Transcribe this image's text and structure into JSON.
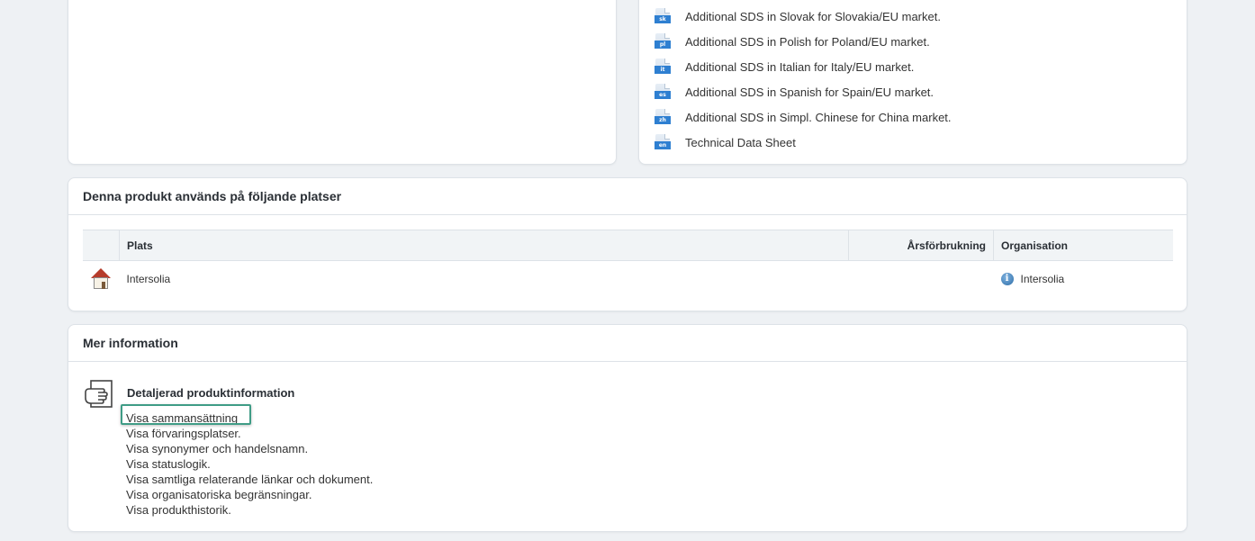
{
  "documents": [
    {
      "code": "sk",
      "label": "Additional SDS in Slovak for Slovakia/EU market."
    },
    {
      "code": "pl",
      "label": "Additional SDS in Polish for Poland/EU market."
    },
    {
      "code": "it",
      "label": "Additional SDS in Italian for Italy/EU market."
    },
    {
      "code": "es",
      "label": "Additional SDS in Spanish for Spain/EU market."
    },
    {
      "code": "zh",
      "label": "Additional SDS in Simpl. Chinese for China market."
    },
    {
      "code": "en",
      "label": "Technical Data Sheet"
    }
  ],
  "usage": {
    "title": "Denna produkt används på följande platser",
    "columns": {
      "place": "Plats",
      "annual_use": "Årsförbrukning",
      "organisation": "Organisation"
    },
    "rows": [
      {
        "icon": "house-icon",
        "place": "Intersolia",
        "annual_use": "",
        "organisation": "Intersolia",
        "org_icon": "info-icon"
      }
    ]
  },
  "more_info": {
    "title": "Mer information",
    "section_title": "Detaljerad produktinformation",
    "section_icon": "document-hand-icon",
    "links": [
      "Visa sammansättning",
      "Visa förvaringsplatser.",
      "Visa synonymer och handelsnamn.",
      "Visa statuslogik.",
      "Visa samtliga relaterande länkar och dokument.",
      "Visa organisatoriska begränsningar.",
      "Visa produkthistorik."
    ],
    "highlighted_link_index": 0
  },
  "colors": {
    "focus": "#3f9c86",
    "doc_badge": "#2e7fd1",
    "background": "#eef1f4"
  }
}
